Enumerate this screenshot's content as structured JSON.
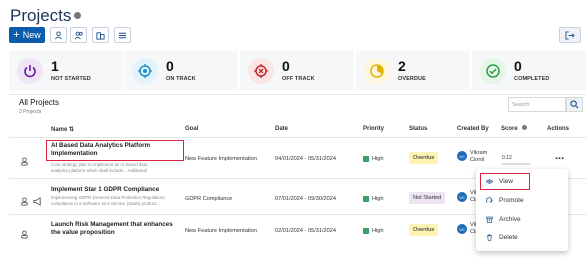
{
  "header": {
    "title": "Projects",
    "new_label": "New"
  },
  "colors": {
    "primary": "#0b5cad",
    "not_started": "#6a1b9a",
    "on_track": "#1a8fd0",
    "off_track": "#c62828",
    "overdue": "#e0b400",
    "completed": "#2e9e47",
    "highlight": "#d7263d"
  },
  "stats": [
    {
      "value": "1",
      "label": "NOT STARTED",
      "icon": "power-icon"
    },
    {
      "value": "0",
      "label": "ON TRACK",
      "icon": "target-icon"
    },
    {
      "value": "0",
      "label": "OFF TRACK",
      "icon": "crosshair-icon"
    },
    {
      "value": "2",
      "label": "OVERDUE",
      "icon": "gauge-icon"
    },
    {
      "value": "0",
      "label": "COMPLETED",
      "icon": "check-circle-icon"
    }
  ],
  "list": {
    "title": "All Projects",
    "count": "3 Projects",
    "search_placeholder": "Search",
    "columns": {
      "name": "Name",
      "goal": "Goal",
      "date": "Date",
      "priority": "Priority",
      "status": "Status",
      "created_by": "Created By",
      "score": "Score",
      "actions": "Actions"
    }
  },
  "rows": [
    {
      "name_line1": "AI Based Data Analytics Platform",
      "name_line2": "Implementation",
      "desc_line1": "Core strategy plan to implement an AI based data",
      "desc_line2": "analytics platform which shall include... Additional",
      "goal": "New Feature Implementation",
      "date": "04/01/2024 - 05/31/2024",
      "priority": "High",
      "status": "Overdue",
      "created_by_1": "Vikram",
      "created_by_2": "Cinnit",
      "avatar": "VC",
      "score": "0.12",
      "actions": "..."
    },
    {
      "name_line1": "Implement Star 1 GDPR Compliance",
      "desc_line1": "Implementing GDPR (General Data Protection Regulation)",
      "desc_line2": "compliance in a Software as a Service (SaaS) product...",
      "goal": "GDPR Compliance",
      "date": "07/01/2024 - 09/30/2024",
      "priority": "High",
      "status": "Not Started",
      "created_by_1": "Vikr",
      "created_by_2": "Cinn",
      "avatar": "VC"
    },
    {
      "name_line1": "Launch Risk Management that enhances",
      "name_line2": "the value proposition",
      "goal": "New Feature Implementation",
      "date": "02/01/2024 - 05/31/2024",
      "priority": "High",
      "status": "Overdue",
      "created_by_1": "Vikr",
      "created_by_2": "Cinn",
      "avatar": "VC"
    }
  ],
  "menu": {
    "view": "View",
    "promote": "Promote",
    "archive": "Archive",
    "delete": "Delete"
  }
}
